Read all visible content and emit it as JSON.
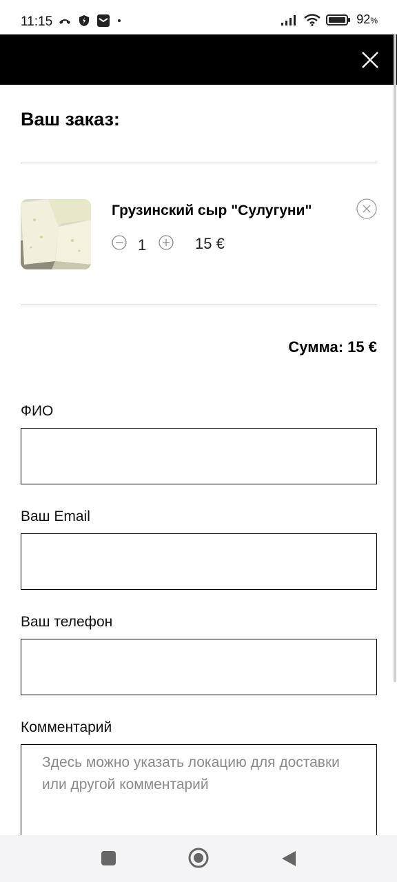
{
  "status_bar": {
    "time": "11:15",
    "battery": "92",
    "battery_unit": "%"
  },
  "order": {
    "title": "Ваш заказ:",
    "item": {
      "name": "Грузинский сыр \"Сулугуни\"",
      "quantity": "1",
      "price": "15 €"
    },
    "total": "Сумма: 15 €"
  },
  "form": {
    "name_label": "ФИО",
    "email_label": "Ваш Email",
    "phone_label": "Ваш телефон",
    "comment_label": "Комментарий",
    "comment_placeholder": "Здесь можно указать локацию для доставки или другой комментарий"
  },
  "icons": {
    "close": "close-icon",
    "remove": "remove-circle-x-icon",
    "minus": "minus-circle-icon",
    "plus": "plus-circle-icon"
  },
  "colors": {
    "header_bg": "#000000",
    "accent": "#000000",
    "placeholder": "#8a8a8a"
  }
}
